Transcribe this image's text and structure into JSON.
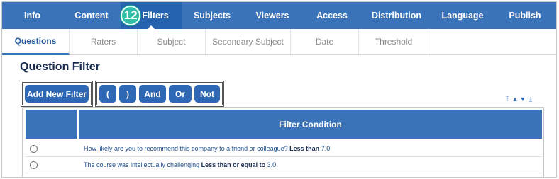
{
  "top_tabs": [
    {
      "label": "Info"
    },
    {
      "label": "Content"
    },
    {
      "label": "Filters",
      "step": "12"
    },
    {
      "label": "Subjects"
    },
    {
      "label": "Viewers"
    },
    {
      "label": "Access"
    },
    {
      "label": "Distribution"
    },
    {
      "label": "Language"
    },
    {
      "label": "Publish"
    }
  ],
  "sub_tabs": [
    {
      "label": "Questions"
    },
    {
      "label": "Raters"
    },
    {
      "label": "Subject"
    },
    {
      "label": "Secondary Subject"
    },
    {
      "label": "Date"
    },
    {
      "label": "Threshold"
    }
  ],
  "page_title": "Question Filter",
  "toolbar": {
    "add_label": "Add New Filter",
    "open_paren": "(",
    "close_paren": ")",
    "and_label": "And",
    "or_label": "Or",
    "not_label": "Not"
  },
  "table": {
    "header": "Filter Condition",
    "rows": [
      {
        "question": "How likely are you to recommend this company to a friend or colleague?",
        "operator": "Less than",
        "value": "7.0"
      },
      {
        "question": "The course was intellectually challenging",
        "operator": "Less than or equal to",
        "value": "3.0"
      }
    ]
  },
  "icons": {
    "sort": [
      "move-to-top-icon",
      "move-up-icon",
      "move-down-icon",
      "move-to-bottom-icon"
    ]
  },
  "colors": {
    "nav": "#3a73b8",
    "nav_active": "#2563ae",
    "button": "#2e67b3",
    "badge": "#2fbfa6"
  }
}
